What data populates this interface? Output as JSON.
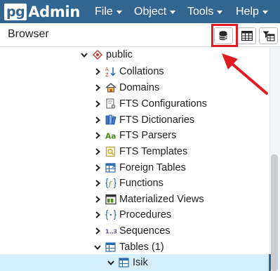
{
  "app": {
    "logo_pg": "pg",
    "logo_admin": "Admin"
  },
  "menu": {
    "file": "File",
    "object": "Object",
    "tools": "Tools",
    "help": "Help"
  },
  "browser": {
    "title": "Browser",
    "toolbar_buttons": [
      "query-tool",
      "view-data",
      "filtered-rows"
    ]
  },
  "tree": {
    "schema": "public",
    "items": [
      "Collations",
      "Domains",
      "FTS Configurations",
      "FTS Dictionaries",
      "FTS Parsers",
      "FTS Templates",
      "Foreign Tables",
      "Functions",
      "Materialized Views",
      "Procedures",
      "Sequences",
      "Tables (1)"
    ],
    "child": "Isik"
  },
  "colors": {
    "navbar": "#326690",
    "highlight": "#e11b22",
    "selected_row": "#d6effc"
  }
}
